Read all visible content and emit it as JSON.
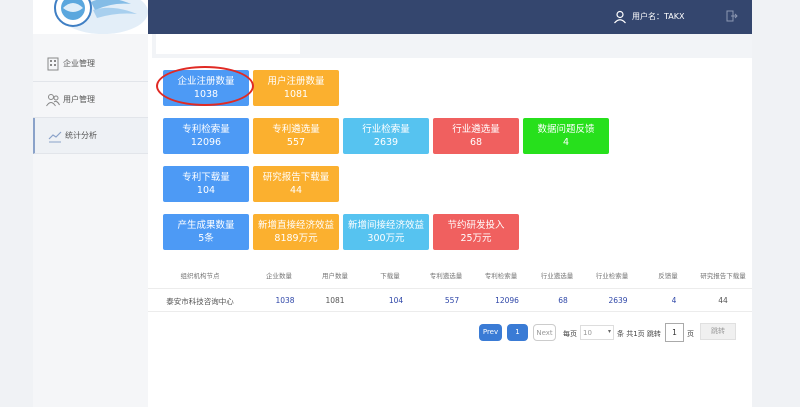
{
  "header": {
    "user_label": "用户名：TAKX"
  },
  "sidebar": {
    "items": [
      {
        "label": "企业管理"
      },
      {
        "label": "用户管理"
      },
      {
        "label": "统计分析"
      }
    ]
  },
  "cards": {
    "row1": [
      {
        "title": "企业注册数量",
        "value": "1038",
        "color": "blue"
      },
      {
        "title": "用户注册数量",
        "value": "1081",
        "color": "orange"
      }
    ],
    "row2": [
      {
        "title": "专利检索量",
        "value": "12096",
        "color": "blue"
      },
      {
        "title": "专利遴选量",
        "value": "557",
        "color": "orange"
      },
      {
        "title": "行业检索量",
        "value": "2639",
        "color": "cyan"
      },
      {
        "title": "行业遴选量",
        "value": "68",
        "color": "red"
      },
      {
        "title": "数据问题反馈",
        "value": "4",
        "color": "green"
      }
    ],
    "row3": [
      {
        "title": "专利下载量",
        "value": "104",
        "color": "blue"
      },
      {
        "title": "研究报告下载量",
        "value": "44",
        "color": "orange"
      }
    ],
    "row4": [
      {
        "title": "产生成果数量",
        "value": "5条",
        "color": "blue"
      },
      {
        "title": "新增直接经济效益",
        "value": "8189万元",
        "color": "orange"
      },
      {
        "title": "新增间接经济效益",
        "value": "300万元",
        "color": "cyan"
      },
      {
        "title": "节约研发投入",
        "value": "25万元",
        "color": "red"
      }
    ]
  },
  "table": {
    "headers": [
      "组织机构节点",
      "企业数量",
      "用户数量",
      "下载量",
      "专利遴选量",
      "专利检索量",
      "行业遴选量",
      "行业检索量",
      "反馈量",
      "研究报告下载量"
    ],
    "rows": [
      [
        "泰安市科技咨询中心",
        "1038",
        "1081",
        "104",
        "557",
        "12096",
        "68",
        "2639",
        "4",
        "44"
      ]
    ]
  },
  "pagination": {
    "prev": "Prev",
    "current": "1",
    "next": "Next",
    "per_page_label": "每页",
    "per_page_value": "10",
    "summary": "条 共1页 跳转",
    "jump_value": "1",
    "page_suffix": "页",
    "jump_button": "跳转"
  },
  "colors": {
    "header_bg": "#34466e",
    "blue": "#4d9af5",
    "orange": "#fbb02f",
    "cyan": "#56c3f0",
    "red": "#f0605f",
    "green": "#27e01c",
    "highlight": "#e02a24"
  }
}
